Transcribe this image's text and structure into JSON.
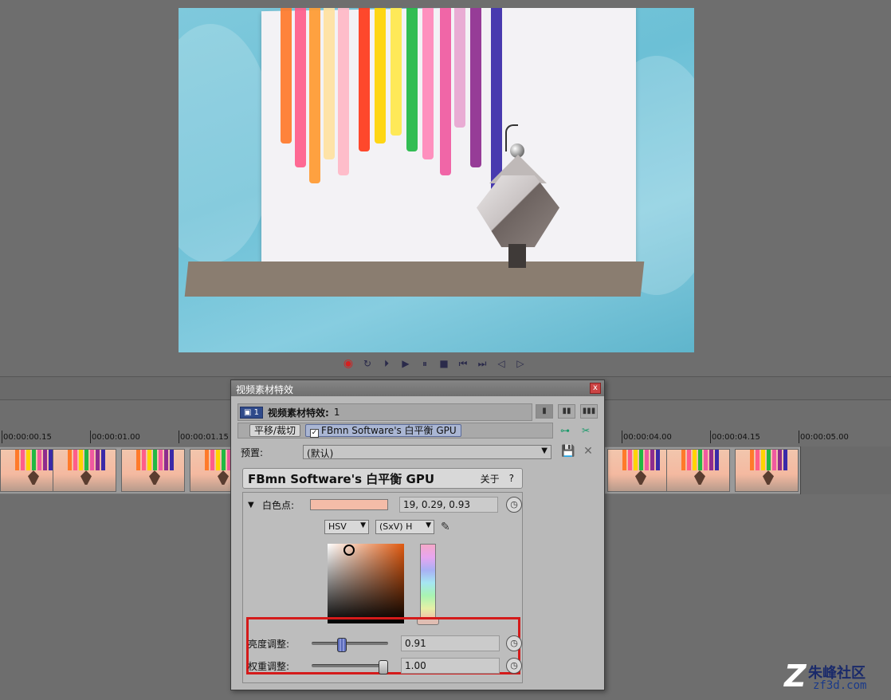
{
  "dialog": {
    "title": "视频素材特效",
    "close": "x",
    "chain_badge": "▣ 1",
    "chain_label": "视频素材特效:",
    "chain_count": "1",
    "plugins": [
      {
        "label": "平移/裁切",
        "checked": false
      },
      {
        "label": "FBmn Software's 白平衡 GPU",
        "checked": true
      }
    ],
    "preset_label": "预置:",
    "preset_value": "(默认)",
    "plugin_title": "FBmn Software's 白平衡 GPU",
    "about": "关于",
    "help": "?",
    "white_point": {
      "label": "白色点:",
      "value": "19, 0.29, 0.93",
      "swatch_color": "#f4bca8"
    },
    "mode": {
      "model": "HSV",
      "axis": "(SxV) H"
    },
    "adjustments": [
      {
        "label": "亮度调整:",
        "value": "0.91",
        "level": 0.38,
        "knob": "blue"
      },
      {
        "label": "权重调整:",
        "value": "1.00",
        "level": 1.0,
        "knob": "gray"
      }
    ]
  },
  "timeline": {
    "ruler": [
      "00:00:00.15",
      "00:00:01.00",
      "00:00:01.15",
      "00:00:04.00",
      "00:00:04.15",
      "00:00:05.00"
    ]
  },
  "transport": {
    "buttons": [
      {
        "name": "record-button",
        "glyph": "◉"
      },
      {
        "name": "loop-button",
        "glyph": "↻"
      },
      {
        "name": "play-from-start-button",
        "glyph": "⏵"
      },
      {
        "name": "play-button",
        "glyph": "▶"
      },
      {
        "name": "pause-button",
        "glyph": "⏸"
      },
      {
        "name": "stop-button",
        "glyph": "■"
      },
      {
        "name": "go-start-button",
        "glyph": "⏮"
      },
      {
        "name": "go-end-button",
        "glyph": "⏭"
      },
      {
        "name": "prev-frame-button",
        "glyph": "◁"
      },
      {
        "name": "next-frame-button",
        "glyph": "▷"
      }
    ]
  },
  "watermark": {
    "name": "朱峰社区",
    "url": "zf3d.com"
  }
}
